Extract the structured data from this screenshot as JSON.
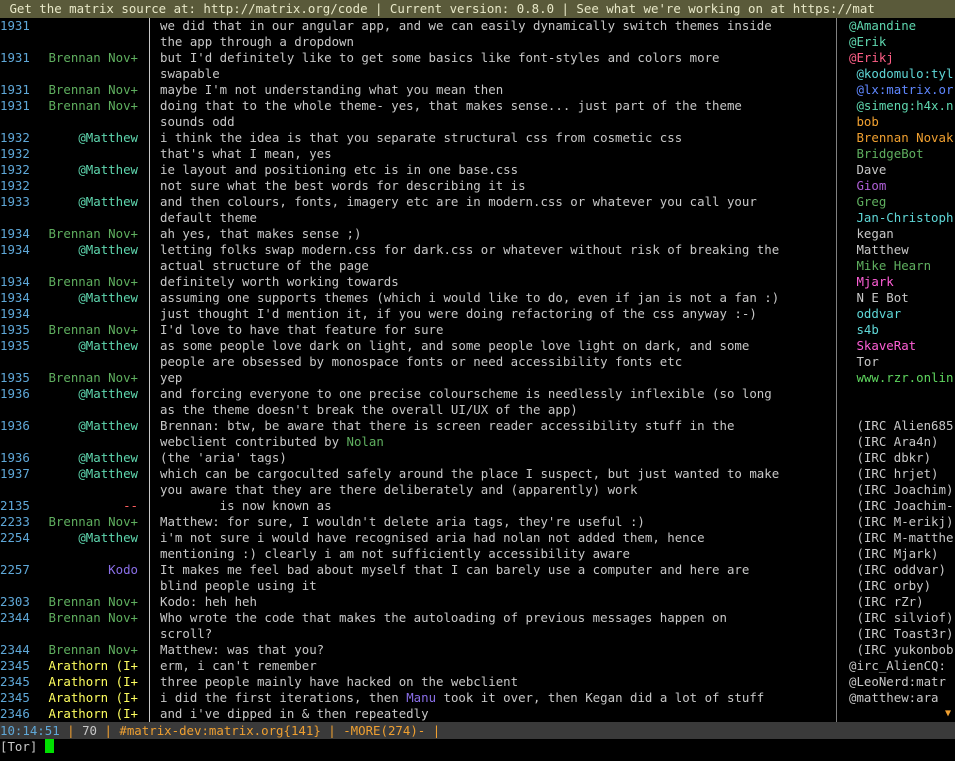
{
  "topic": " Get the matrix source at: http://matrix.org/code | Current version: 0.8.0 | See what we're working on at https://mat",
  "messages": [
    {
      "ts": "1931",
      "nick": "",
      "nc": "",
      "text": "we did that in our angular app, and we can easily dynamically switch themes inside"
    },
    {
      "ts": "",
      "nick": "",
      "nc": "",
      "text": "the app through a dropdown"
    },
    {
      "ts": "1931",
      "nick": "Brennan Nov+",
      "nc": "brennan",
      "text": "but I'd definitely like to get some basics like font-styles and colors more"
    },
    {
      "ts": "",
      "nick": "",
      "nc": "",
      "text": "swapable"
    },
    {
      "ts": "1931",
      "nick": "Brennan Nov+",
      "nc": "brennan",
      "text": "maybe I'm not understanding what you mean then"
    },
    {
      "ts": "1931",
      "nick": "Brennan Nov+",
      "nc": "brennan",
      "text": "doing that to the whole theme- yes, that makes sense... just part of the theme"
    },
    {
      "ts": "",
      "nick": "",
      "nc": "",
      "text": "sounds odd"
    },
    {
      "ts": "1932",
      "nick": "@Matthew",
      "nc": "matthew",
      "text": "i think the idea is that you separate structural css from cosmetic css"
    },
    {
      "ts": "1932",
      "nick": "",
      "nc": "",
      "text": "that's what I mean, yes"
    },
    {
      "ts": "1932",
      "nick": "@Matthew",
      "nc": "matthew",
      "text": "ie layout and positioning etc is in one base.css"
    },
    {
      "ts": "1932",
      "nick": "",
      "nc": "",
      "text": "not sure what the best words for describing it is"
    },
    {
      "ts": "1933",
      "nick": "@Matthew",
      "nc": "matthew",
      "text": "and then colours, fonts, imagery etc are in modern.css or whatever you call your"
    },
    {
      "ts": "",
      "nick": "",
      "nc": "",
      "text": "default theme"
    },
    {
      "ts": "1934",
      "nick": "Brennan Nov+",
      "nc": "brennan",
      "text": "ah yes, that makes sense ;)"
    },
    {
      "ts": "1934",
      "nick": "@Matthew",
      "nc": "matthew",
      "text": "letting folks swap modern.css for dark.css or whatever without risk of breaking the"
    },
    {
      "ts": "",
      "nick": "",
      "nc": "",
      "text": "actual structure of the page"
    },
    {
      "ts": "1934",
      "nick": "Brennan Nov+",
      "nc": "brennan",
      "text": "definitely worth working towards"
    },
    {
      "ts": "1934",
      "nick": "@Matthew",
      "nc": "matthew",
      "text": "assuming one supports themes (which i would like to do, even if jan is not a fan :)"
    },
    {
      "ts": "1934",
      "nick": "",
      "nc": "",
      "text": "just thought I'd mention it, if you were doing refactoring of the css anyway :-)"
    },
    {
      "ts": "1935",
      "nick": "Brennan Nov+",
      "nc": "brennan",
      "text": "I'd love to have that feature for sure"
    },
    {
      "ts": "1935",
      "nick": "@Matthew",
      "nc": "matthew",
      "text": "as some people love dark on light, and some people love light on dark, and some"
    },
    {
      "ts": "",
      "nick": "",
      "nc": "",
      "text": "people are obsessed by monospace fonts or need accessibility fonts etc"
    },
    {
      "ts": "1935",
      "nick": "Brennan Nov+",
      "nc": "brennan",
      "text": "yep"
    },
    {
      "ts": "1936",
      "nick": "@Matthew",
      "nc": "matthew",
      "text": "and forcing everyone to one precise colourscheme is needlessly inflexible (so long"
    },
    {
      "ts": "",
      "nick": "",
      "nc": "",
      "text": "as the theme doesn't break the overall UI/UX of the app)"
    },
    {
      "ts": "1936",
      "nick": "@Matthew",
      "nc": "matthew",
      "text": "Brennan: btw, be aware that there is screen reader accessibility stuff in the"
    },
    {
      "ts": "",
      "nick": "",
      "nc": "",
      "text": "webclient contributed by ",
      "hl": "Nolan",
      "hlc": "nolan"
    },
    {
      "ts": "1936",
      "nick": "@Matthew",
      "nc": "matthew",
      "text": "(the 'aria' tags)"
    },
    {
      "ts": "1937",
      "nick": "@Matthew",
      "nc": "matthew",
      "text": "which can be cargoculted safely around the place I suspect, but just wanted to make"
    },
    {
      "ts": "",
      "nick": "",
      "nc": "",
      "text": "you aware that they are there deliberately and (apparently) work"
    },
    {
      "ts": "2135",
      "nick": "--",
      "nc": "dash",
      "text": "        is now known as"
    },
    {
      "ts": "2233",
      "nick": "Brennan Nov+",
      "nc": "brennan",
      "text": "Matthew: for sure, I wouldn't delete aria tags, they're useful :)"
    },
    {
      "ts": "2254",
      "nick": "@Matthew",
      "nc": "matthew",
      "text": "i'm not sure i would have recognised aria had nolan not added them, hence"
    },
    {
      "ts": "",
      "nick": "",
      "nc": "",
      "text": "mentioning :) clearly i am not sufficiently accessibility aware"
    },
    {
      "ts": "2257",
      "nick": "Kodo",
      "nc": "kodo",
      "text": "It makes me feel bad about myself that I can barely use a computer and here are"
    },
    {
      "ts": "",
      "nick": "",
      "nc": "",
      "text": "blind people using it"
    },
    {
      "ts": "2303",
      "nick": "Brennan Nov+",
      "nc": "brennan",
      "text": "Kodo: heh heh"
    },
    {
      "ts": "2344",
      "nick": "Brennan Nov+",
      "nc": "brennan",
      "text": "Who wrote the code that makes the autoloading of previous messages happen on"
    },
    {
      "ts": "",
      "nick": "",
      "nc": "",
      "text": "scroll?"
    },
    {
      "ts": "2344",
      "nick": "Brennan Nov+",
      "nc": "brennan",
      "text": "Matthew: was that you?"
    },
    {
      "ts": "2345",
      "nick": "Arathorn (I+",
      "nc": "arathorn",
      "text": "erm, i can't remember"
    },
    {
      "ts": "2345",
      "nick": "Arathorn (I+",
      "nc": "arathorn",
      "text": "three people mainly have hacked on the webclient"
    },
    {
      "ts": "2345",
      "nick": "Arathorn (I+",
      "nc": "arathorn",
      "text": "i did the first iterations, then ",
      "hl": "Manu",
      "hlc": "manu",
      "tail": " took it over, then Kegan did a lot of stuff"
    },
    {
      "ts": "2346",
      "nick": "Arathorn (I+",
      "nc": "arathorn",
      "text": "and i've dipped in & then repeatedly"
    }
  ],
  "nicklist": [
    {
      "name": "@Amandine",
      "color": "#5fd7af"
    },
    {
      "name": "@Erik",
      "color": "#5fd7af"
    },
    {
      "name": "@Erikj",
      "color": "#ff5f87"
    },
    {
      "name": " @kodomulo:tyl",
      "color": "#5fd7d7"
    },
    {
      "name": " @lx:matrix.or",
      "color": "#5f87ff"
    },
    {
      "name": " @simeng:h4x.n",
      "color": "#5fd7af"
    },
    {
      "name": " bob",
      "color": "#f0a030"
    },
    {
      "name": " Brennan Novak",
      "color": "#f0a030"
    },
    {
      "name": " BridgeBot",
      "color": "#5faf5f"
    },
    {
      "name": " Dave",
      "color": "#c8c8c8"
    },
    {
      "name": " Giom",
      "color": "#af5fd7"
    },
    {
      "name": " Greg",
      "color": "#5faf5f"
    },
    {
      "name": " Jan-Christoph",
      "color": "#5fd7d7"
    },
    {
      "name": " kegan",
      "color": "#c8c8c8"
    },
    {
      "name": " Matthew",
      "color": "#c8c8c8"
    },
    {
      "name": " Mike Hearn",
      "color": "#5faf5f"
    },
    {
      "name": " Mjark",
      "color": "#ff5fd7"
    },
    {
      "name": " N E Bot",
      "color": "#c8c8c8"
    },
    {
      "name": " oddvar",
      "color": "#5fd7d7"
    },
    {
      "name": " s4b",
      "color": "#5fd7d7"
    },
    {
      "name": " SkaveRat",
      "color": "#ff5fd7"
    },
    {
      "name": " Tor",
      "color": "#c8c8c8"
    },
    {
      "name": " www.rzr.onlin",
      "color": "#5fd75f"
    },
    {
      "name": "",
      "color": "#c8c8c8"
    },
    {
      "name": "",
      "color": "#c8c8c8"
    },
    {
      "name": " (IRC Alien685",
      "color": "#c8c8c8"
    },
    {
      "name": " (IRC Ara4n)",
      "color": "#c8c8c8"
    },
    {
      "name": " (IRC dbkr)",
      "color": "#c8c8c8"
    },
    {
      "name": " (IRC hrjet)",
      "color": "#c8c8c8"
    },
    {
      "name": " (IRC Joachim)",
      "color": "#c8c8c8"
    },
    {
      "name": " (IRC Joachim-",
      "color": "#c8c8c8"
    },
    {
      "name": " (IRC M-erikj)",
      "color": "#c8c8c8"
    },
    {
      "name": " (IRC M-matthe",
      "color": "#c8c8c8"
    },
    {
      "name": " (IRC Mjark)",
      "color": "#c8c8c8"
    },
    {
      "name": " (IRC oddvar)",
      "color": "#c8c8c8"
    },
    {
      "name": " (IRC orby)",
      "color": "#c8c8c8"
    },
    {
      "name": " (IRC rZr)",
      "color": "#c8c8c8"
    },
    {
      "name": " (IRC silviof)",
      "color": "#c8c8c8"
    },
    {
      "name": " (IRC Toast3r)",
      "color": "#c8c8c8"
    },
    {
      "name": " (IRC yukonbob",
      "color": "#c8c8c8"
    },
    {
      "name": "@irc_AlienCQ:",
      "color": "#c8c8c8"
    },
    {
      "name": "@LeoNerd:matr",
      "color": "#c8c8c8"
    },
    {
      "name": "@matthew:ara",
      "color": "#c8c8c8"
    }
  ],
  "status": {
    "time": "10:14:51",
    "count": "70",
    "channel": "#matrix-dev:matrix.org{141}",
    "more": "-MORE(274)-"
  },
  "input": {
    "prompt": "[Tor]",
    "value": ""
  },
  "scroll_indicator": "▼"
}
